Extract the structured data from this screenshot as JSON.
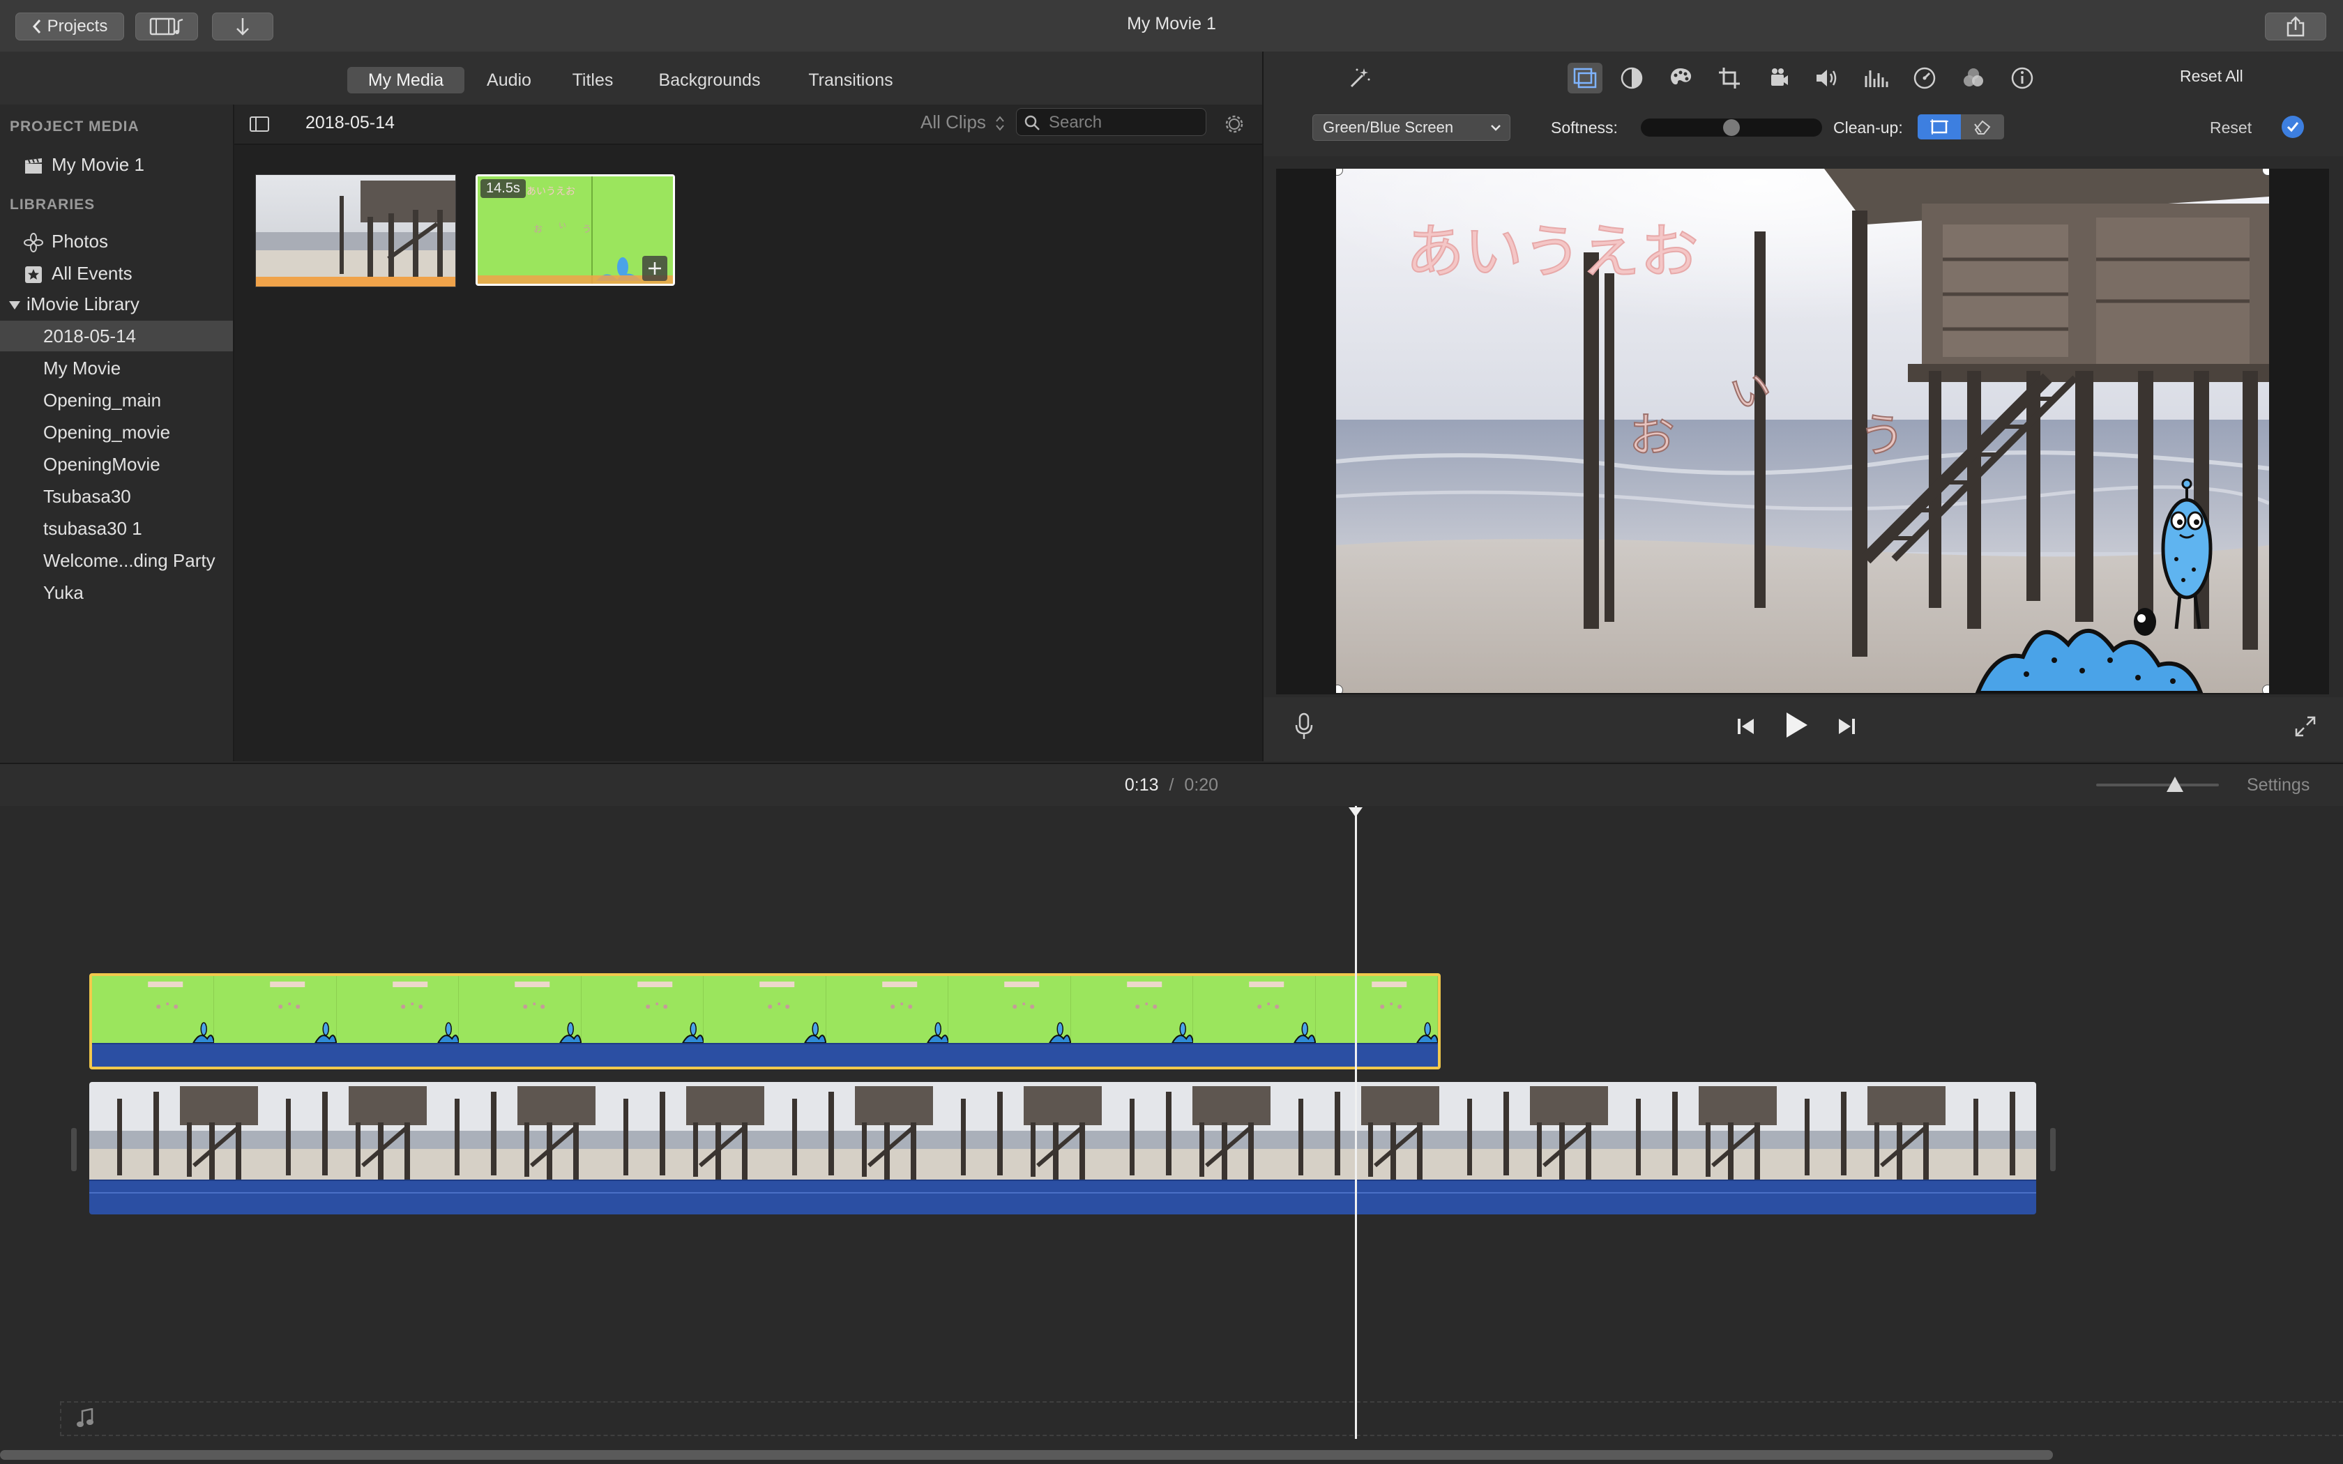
{
  "window": {
    "title": "My Movie 1"
  },
  "toolbar": {
    "projects_label": "Projects"
  },
  "browser": {
    "tabs": [
      "My Media",
      "Audio",
      "Titles",
      "Backgrounds",
      "Transitions"
    ],
    "active_tab": "My Media",
    "date": "2018-05-14",
    "filter": "All Clips",
    "search_placeholder": "Search"
  },
  "sidebar": {
    "project_media_heading": "PROJECT MEDIA",
    "project_item": "My Movie 1",
    "libraries_heading": "LIBRARIES",
    "photos": "Photos",
    "all_events": "All Events",
    "library": "iMovie Library",
    "events": [
      "2018-05-14",
      "My Movie",
      "Opening_main",
      "Opening_movie",
      "OpeningMovie",
      "Tsubasa30",
      "tsubasa30 1",
      "Welcome...ding Party",
      "Yuka"
    ],
    "selected_event": "2018-05-14"
  },
  "media": {
    "clip_duration": "14.5s"
  },
  "adjust": {
    "effect": "Green/Blue Screen",
    "softness_label": "Softness:",
    "softness_value": 0.5,
    "cleanup_label": "Clean-up:",
    "reset_label": "Reset",
    "reset_all_label": "Reset All"
  },
  "viewer": {
    "title_text": "あいうえお",
    "chars": [
      "お",
      "い",
      "う"
    ]
  },
  "timeline": {
    "current_time": "0:13",
    "separator": "/",
    "total_time": "0:20",
    "settings_label": "Settings",
    "playhead_fraction": 0.65,
    "zoom_fraction": 0.64
  },
  "colors": {
    "green_screen": "#9be55d",
    "selection": "#f2c94c",
    "audio_band": "#2b4fa3",
    "accent": "#4a90e2"
  }
}
